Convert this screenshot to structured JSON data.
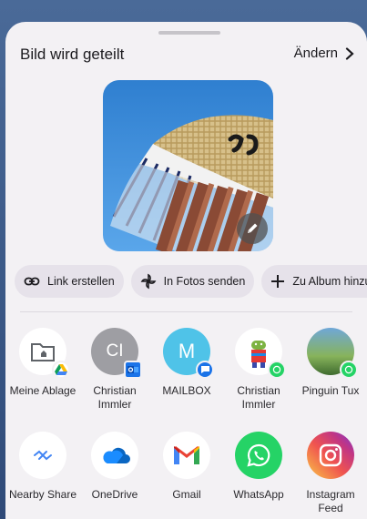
{
  "header": {
    "title": "Bild wird geteilt",
    "change_label": "Ändern"
  },
  "actions": [
    {
      "label": "Link erstellen",
      "icon": "link-icon"
    },
    {
      "label": "In Fotos senden",
      "icon": "pinwheel-icon"
    },
    {
      "label": "Zu Album hinzufü",
      "icon": "plus-icon"
    }
  ],
  "targets_row1": [
    {
      "label": "Meine Ablage",
      "icon": "drive-folder-icon"
    },
    {
      "label": "Christian Immler",
      "avatar_text": "CI",
      "icon": "outlook-badge-icon"
    },
    {
      "label": "MAILBOX",
      "avatar_text": "M",
      "icon": "message-badge-icon"
    },
    {
      "label": "Christian Immler",
      "icon": "android-whatsapp-icon"
    },
    {
      "label": "Pinguin Tux",
      "icon": "photo-whatsapp-icon"
    }
  ],
  "targets_row2": [
    {
      "label": "Nearby Share",
      "icon": "nearby-share-icon"
    },
    {
      "label": "OneDrive",
      "icon": "onedrive-icon"
    },
    {
      "label": "Gmail",
      "icon": "gmail-icon"
    },
    {
      "label": "WhatsApp",
      "icon": "whatsapp-icon"
    },
    {
      "label": "Instagram Feed",
      "icon": "instagram-icon"
    }
  ],
  "colors": {
    "sheet": "#f3f1f4",
    "chip": "#e6e2ea",
    "whatsapp": "#25d366",
    "mailbox": "#4fc3e8",
    "ci_avatar": "#9e9ea3"
  }
}
